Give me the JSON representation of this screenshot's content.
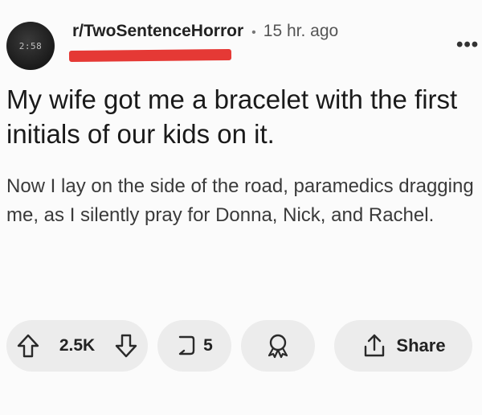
{
  "post": {
    "avatar_text": "2:58",
    "subreddit": "r/TwoSentenceHorror",
    "separator": "•",
    "time_ago": "15 hr. ago",
    "more_label": "•••",
    "title": "My wife got me a bracelet with the first initials of our kids on it.",
    "body": "Now I lay on the side of the road, paramedics dragging me, as I silently pray for Donna, Nick, and Rachel."
  },
  "actions": {
    "vote_count": "2.5K",
    "comment_count": "5",
    "share_label": "Share"
  },
  "icons": {
    "upvote": "arrow-up-outline-icon",
    "downvote": "arrow-down-outline-icon",
    "comment": "speech-bubble-icon",
    "award": "award-ribbon-icon",
    "share": "share-upload-icon",
    "more": "ellipsis-icon"
  },
  "colors": {
    "redaction": "#e53935",
    "pill_background": "#ececec",
    "page_background": "#fbfbfb"
  }
}
